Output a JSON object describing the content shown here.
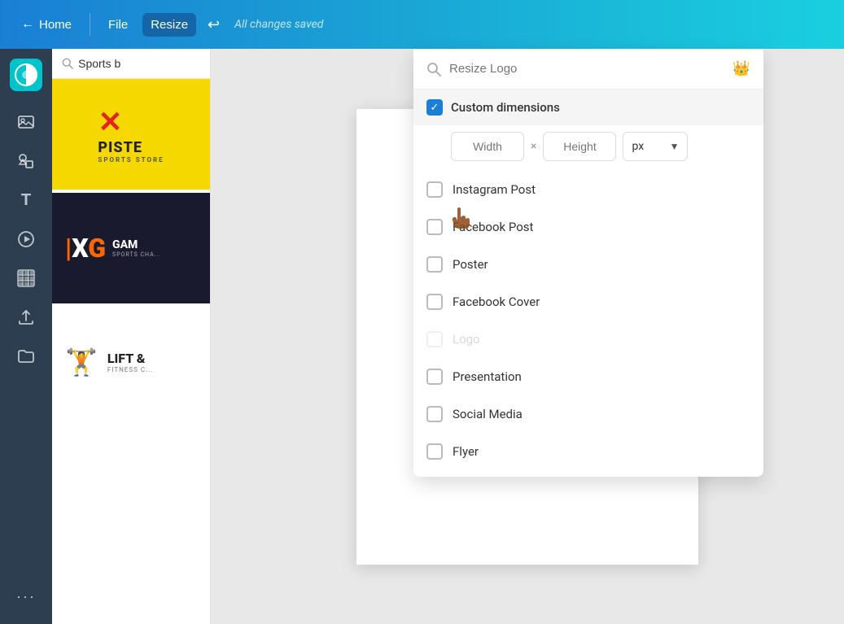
{
  "topbar": {
    "home_label": "Home",
    "file_label": "File",
    "resize_label": "Resize",
    "saved_label": "All changes saved",
    "back_arrow": "←",
    "undo_symbol": "↩"
  },
  "sidebar_icons": {
    "logo_symbol": "◑",
    "icons": [
      {
        "name": "images-icon",
        "symbol": "🖼",
        "label": "Photos"
      },
      {
        "name": "elements-icon",
        "symbol": "❤",
        "label": "Elements"
      },
      {
        "name": "text-icon",
        "symbol": "T",
        "label": "Text"
      },
      {
        "name": "video-icon",
        "symbol": "▷",
        "label": "Video"
      },
      {
        "name": "texture-icon",
        "symbol": "⊞",
        "label": "Background"
      },
      {
        "name": "upload-icon",
        "symbol": "⬆",
        "label": "Uploads"
      },
      {
        "name": "folder-icon",
        "symbol": "📁",
        "label": "Folders"
      },
      {
        "name": "more-icon",
        "symbol": "···",
        "label": "More"
      }
    ]
  },
  "search": {
    "placeholder": "Sports b",
    "value": "Sports b"
  },
  "templates": [
    {
      "name": "piste-template",
      "type": "yellow"
    },
    {
      "name": "xg-template",
      "type": "dark"
    },
    {
      "name": "lift-template",
      "type": "lift"
    }
  ],
  "resize_dropdown": {
    "search_placeholder": "Resize Logo",
    "crown_icon": "👑",
    "custom_dimensions_label": "Custom dimensions",
    "width_placeholder": "Width",
    "height_placeholder": "Height",
    "unit": "px",
    "options": [
      {
        "label": "Instagram Post",
        "checked": false,
        "disabled": false
      },
      {
        "label": "Facebook Post",
        "checked": false,
        "disabled": false
      },
      {
        "label": "Poster",
        "checked": false,
        "disabled": false
      },
      {
        "label": "Facebook Cover",
        "checked": false,
        "disabled": false
      },
      {
        "label": "Logo",
        "checked": false,
        "disabled": true
      },
      {
        "label": "Presentation",
        "checked": false,
        "disabled": false
      },
      {
        "label": "Social Media",
        "checked": false,
        "disabled": false
      },
      {
        "label": "Flyer",
        "checked": false,
        "disabled": false
      }
    ]
  },
  "canvas": {
    "bg_color": "#e8e8e8",
    "doc_bg": "white",
    "circle_color": "#e52222"
  },
  "colors": {
    "topbar_start": "#1a7fd4",
    "topbar_end": "#1acfe0",
    "sidebar_bg": "#2c3e50",
    "resize_active": "#1565a8",
    "checkbox_checked": "#1a7fd4"
  }
}
